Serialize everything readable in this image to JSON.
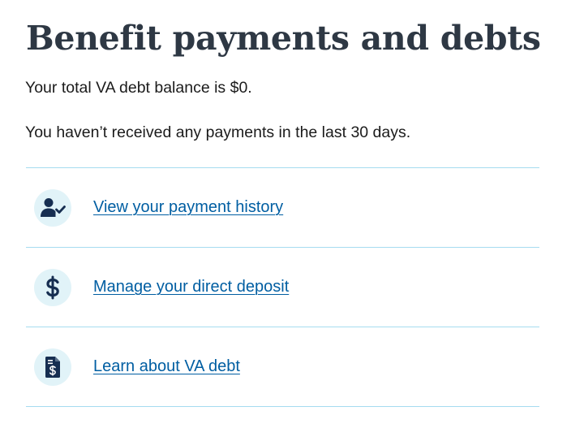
{
  "page": {
    "title": "Benefit payments and debts"
  },
  "summary": {
    "debt_text": "Your total VA debt balance is $0.",
    "payments_text": "You haven’t received any payments in the last 30 days."
  },
  "links": [
    {
      "label": "View your payment history",
      "icon": "user-check-icon"
    },
    {
      "label": "Manage your direct deposit",
      "icon": "dollar-sign-icon"
    },
    {
      "label": "Learn about VA debt",
      "icon": "dollar-document-icon"
    }
  ],
  "colors": {
    "heading": "#2e3844",
    "link": "#005ea2",
    "divider": "#a6dcf0",
    "icon_background": "#e1f3f8",
    "icon_foreground": "#162e51"
  }
}
